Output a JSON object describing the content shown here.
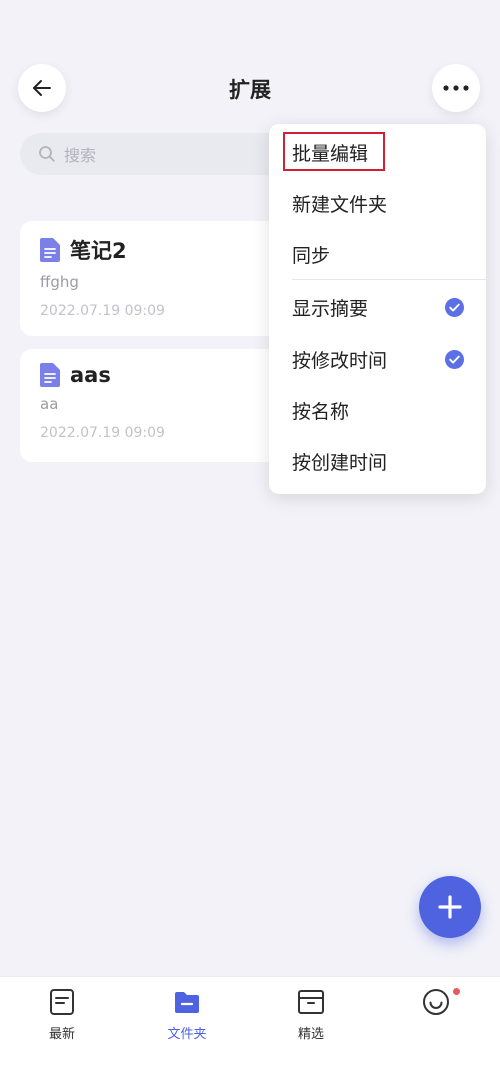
{
  "header": {
    "title": "扩展",
    "back_icon": "arrow-left-icon",
    "more_icon": "more-dots-icon"
  },
  "search": {
    "placeholder": "搜索",
    "icon": "search-icon"
  },
  "notes": [
    {
      "title": "笔记2",
      "preview": "ffghg",
      "date": "2022.07.19 09:09"
    },
    {
      "title": "aas",
      "preview": "aa",
      "date": "2022.07.19 09:09"
    }
  ],
  "menu": {
    "items": [
      {
        "label": "批量编辑",
        "checked": false,
        "highlighted": true
      },
      {
        "label": "新建文件夹",
        "checked": false
      },
      {
        "label": "同步",
        "checked": false
      },
      {
        "label": "显示摘要",
        "checked": true
      },
      {
        "label": "按修改时间",
        "checked": true
      },
      {
        "label": "按名称",
        "checked": false
      },
      {
        "label": "按创建时间",
        "checked": false
      }
    ]
  },
  "fab": {
    "icon": "plus-icon"
  },
  "tabbar": {
    "tabs": [
      {
        "label": "最新",
        "icon": "note-icon",
        "active": false
      },
      {
        "label": "文件夹",
        "icon": "folder-icon",
        "active": true
      },
      {
        "label": "精选",
        "icon": "archive-box-icon",
        "active": false
      },
      {
        "label": "",
        "icon": "smiley-icon",
        "active": false,
        "badge": true
      }
    ]
  },
  "colors": {
    "accent": "#4f63e0",
    "background": "#f2f2f8",
    "highlight_border": "#d32030",
    "badge": "#e85a5a"
  }
}
